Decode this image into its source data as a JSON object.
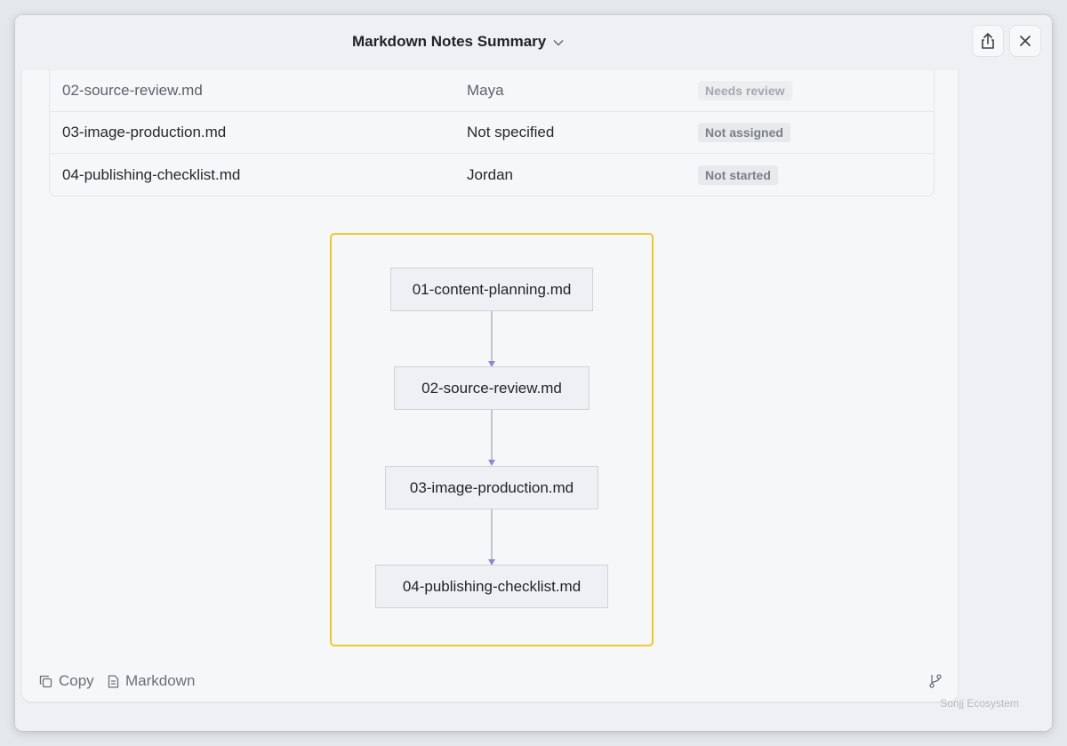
{
  "window": {
    "title": "Markdown Notes Summary"
  },
  "table": {
    "rows": [
      {
        "file": "02-source-review.md",
        "owner": "Maya",
        "status": "Needs review"
      },
      {
        "file": "03-image-production.md",
        "owner": "Not specified",
        "status": "Not assigned"
      },
      {
        "file": "04-publishing-checklist.md",
        "owner": "Jordan",
        "status": "Not started"
      }
    ]
  },
  "diagram": {
    "nodes": [
      "01-content-planning.md",
      "02-source-review.md",
      "03-image-production.md",
      "04-publishing-checklist.md"
    ],
    "border_color": "#f2c62d",
    "arrow_color": "#8f86cf"
  },
  "footer": {
    "copy_label": "Copy",
    "markdown_label": "Markdown"
  },
  "watermark": "Sonjj Ecosystem",
  "icons": {
    "title_dropdown": "chevron-down-icon",
    "share": "share-icon",
    "close": "close-icon",
    "copy": "copy-icon",
    "markdown": "document-icon",
    "branch": "git-branch-icon"
  }
}
